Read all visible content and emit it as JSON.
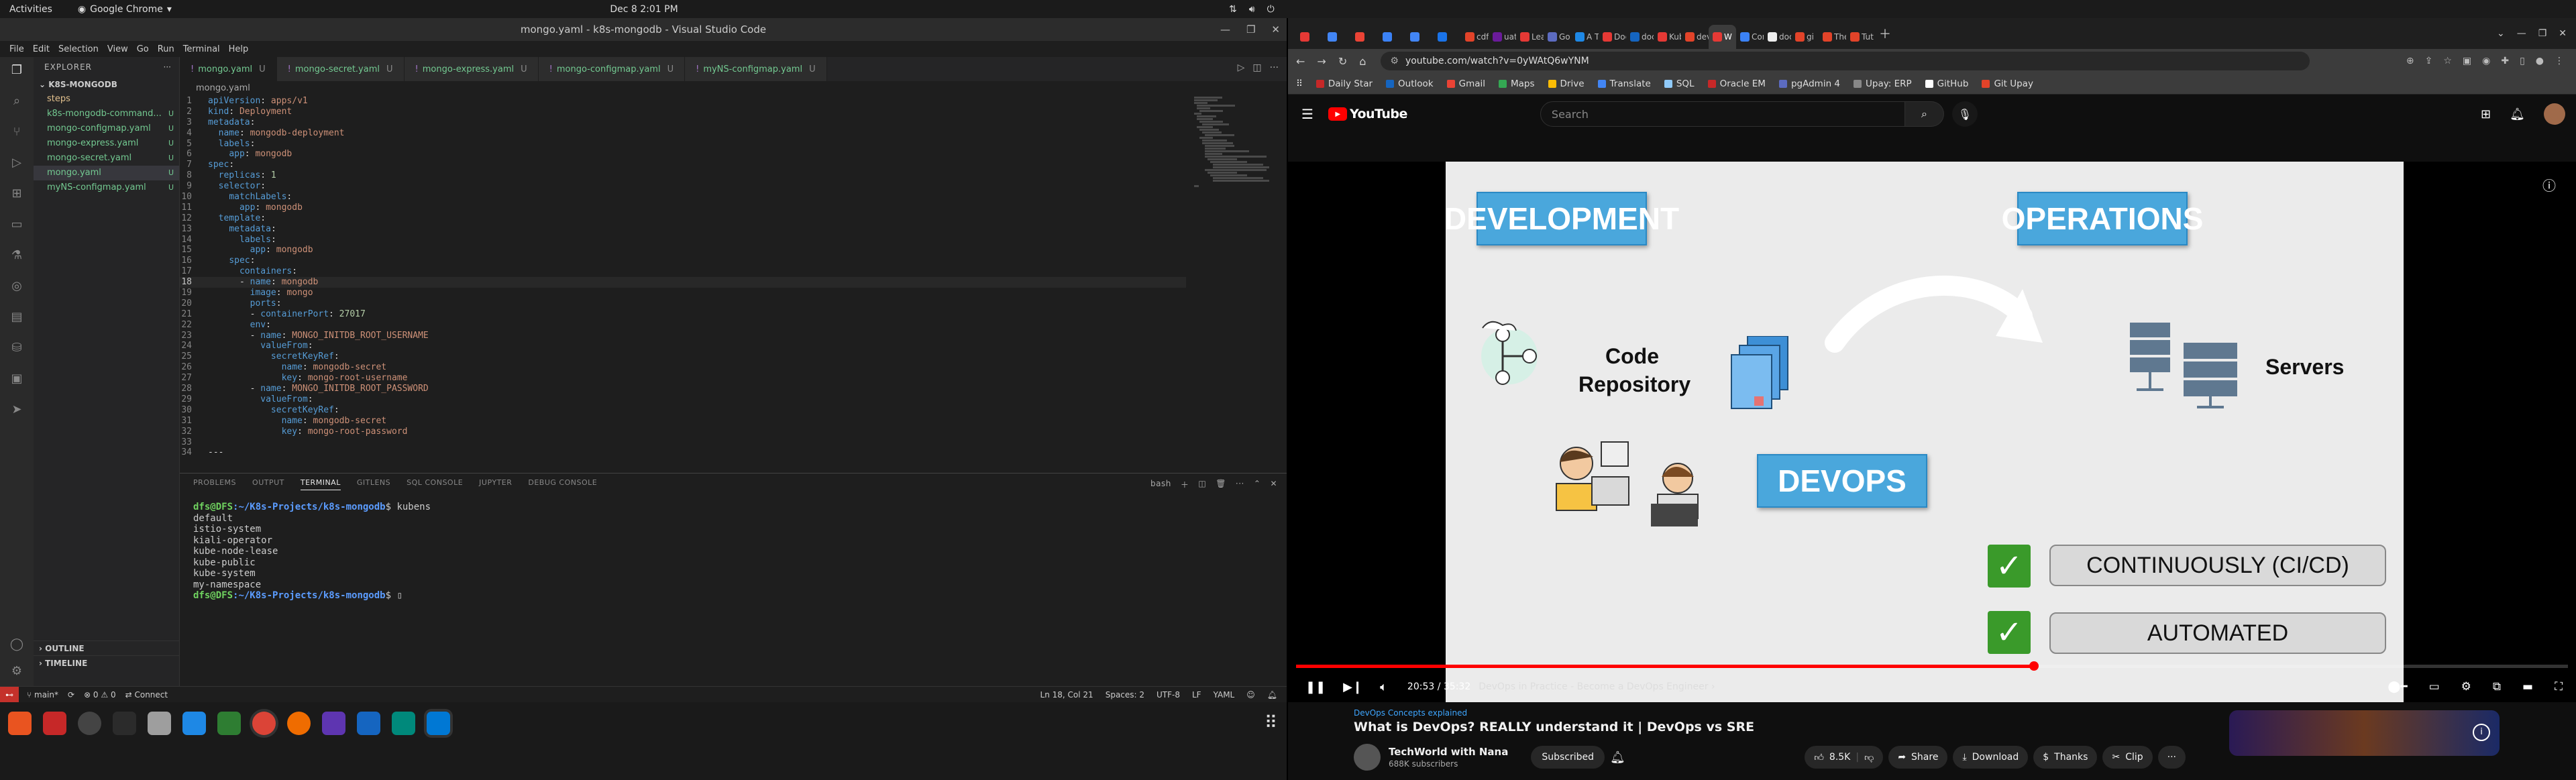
{
  "topbar": {
    "activities": "Activities",
    "app": "Google Chrome",
    "clock": "Dec 8  2:01 PM"
  },
  "vscode": {
    "title": "mongo.yaml - k8s-mongodb - Visual Studio Code",
    "menu": [
      "File",
      "Edit",
      "Selection",
      "View",
      "Go",
      "Run",
      "Terminal",
      "Help"
    ],
    "explorer_label": "EXPLORER",
    "folder": "K8S-MONGODB",
    "files": [
      {
        "name": "steps",
        "flag": "",
        "folder": true,
        "selected": false
      },
      {
        "name": "k8s-mongodb-command...",
        "flag": "U",
        "folder": false,
        "selected": false
      },
      {
        "name": "mongo-configmap.yaml",
        "flag": "U",
        "folder": false,
        "selected": false
      },
      {
        "name": "mongo-express.yaml",
        "flag": "U",
        "folder": false,
        "selected": false
      },
      {
        "name": "mongo-secret.yaml",
        "flag": "U",
        "folder": false,
        "selected": false
      },
      {
        "name": "mongo.yaml",
        "flag": "U",
        "folder": false,
        "selected": true
      },
      {
        "name": "myNS-configmap.yaml",
        "flag": "U",
        "folder": false,
        "selected": false
      }
    ],
    "outline": "OUTLINE",
    "timeline": "TIMELINE",
    "tabs": [
      {
        "label": "mongo.yaml",
        "flag": "U",
        "active": true
      },
      {
        "label": "mongo-secret.yaml",
        "flag": "U",
        "active": false
      },
      {
        "label": "mongo-express.yaml",
        "flag": "U",
        "active": false
      },
      {
        "label": "mongo-configmap.yaml",
        "flag": "U",
        "active": false
      },
      {
        "label": "myNS-configmap.yaml",
        "flag": "U",
        "active": false
      }
    ],
    "breadcrumb": "mongo.yaml",
    "code": [
      "apiVersion: apps/v1",
      "kind: Deployment",
      "metadata:",
      "  name: mongodb-deployment",
      "  labels:",
      "    app: mongodb",
      "spec:",
      "  replicas: 1",
      "  selector:",
      "    matchLabels:",
      "      app: mongodb",
      "  template:",
      "    metadata:",
      "      labels:",
      "        app: mongodb",
      "    spec:",
      "      containers:",
      "      - name: mongodb",
      "        image: mongo",
      "        ports:",
      "        - containerPort: 27017",
      "        env:",
      "        - name: MONGO_INITDB_ROOT_USERNAME",
      "          valueFrom:",
      "            secretKeyRef:",
      "              name: mongodb-secret",
      "              key: mongo-root-username",
      "        - name: MONGO_INITDB_ROOT_PASSWORD",
      "          valueFrom:",
      "            secretKeyRef:",
      "              name: mongodb-secret",
      "              key: mongo-root-password",
      "",
      "---"
    ],
    "current_line": 18,
    "panel_tabs": [
      "PROBLEMS",
      "OUTPUT",
      "TERMINAL",
      "GITLENS",
      "SQL CONSOLE",
      "JUPYTER",
      "DEBUG CONSOLE"
    ],
    "active_panel_tab": "TERMINAL",
    "terminal_shell": "bash",
    "terminal": {
      "prompt_user": "dfs@DFS",
      "prompt_path": ":~/K8s-Projects/k8s-mongodb",
      "command": "$ kubens",
      "output": [
        "default",
        "istio-system",
        "kiali-operator",
        "kube-node-lease",
        "kube-public",
        "kube-system",
        "my-namespace"
      ],
      "final_prompt_suffix": "$ ▯"
    },
    "status": {
      "branch": "main*",
      "problems": "⊗ 0 ⚠ 0",
      "connect": "Connect",
      "cursor": "Ln 18, Col 21",
      "spaces": "Spaces: 2",
      "encoding": "UTF-8",
      "eol": "LF",
      "language": "YAML"
    }
  },
  "chrome": {
    "tabs": [
      {
        "title": "",
        "color": "#e53935",
        "active": false
      },
      {
        "title": "",
        "color": "#4285f4",
        "active": false
      },
      {
        "title": "",
        "color": "#ea4335",
        "active": false
      },
      {
        "title": "",
        "color": "#3b82f6",
        "active": false
      },
      {
        "title": "",
        "color": "#4285f4",
        "active": false
      },
      {
        "title": "",
        "color": "#1a73e8",
        "active": false
      },
      {
        "title": "cdfs",
        "color": "#e24329",
        "active": false
      },
      {
        "title": "uat",
        "color": "#6a1b9a",
        "active": false
      },
      {
        "title": "Lea",
        "color": "#e53935",
        "active": false
      },
      {
        "title": "Go",
        "color": "#5c6bc0",
        "active": false
      },
      {
        "title": "A Te",
        "color": "#1e88e5",
        "active": false
      },
      {
        "title": "Doc",
        "color": "#e53935",
        "active": false
      },
      {
        "title": "doc",
        "color": "#1565c0",
        "active": false
      },
      {
        "title": "Kub",
        "color": "#e53935",
        "active": false
      },
      {
        "title": "dev",
        "color": "#e24329",
        "active": false
      },
      {
        "title": "W",
        "color": "#e53935",
        "active": true
      },
      {
        "title": "Con",
        "color": "#3b82f6",
        "active": false
      },
      {
        "title": "doc",
        "color": "#eeeeee",
        "active": false
      },
      {
        "title": "gi",
        "color": "#e24329",
        "active": false
      },
      {
        "title": "The",
        "color": "#e24329",
        "active": false
      },
      {
        "title": "Tut",
        "color": "#e24329",
        "active": false
      }
    ],
    "url": "youtube.com/watch?v=0yWAtQ6wYNM",
    "bookmarks": [
      {
        "label": "Daily Star",
        "color": "#c62828"
      },
      {
        "label": "Outlook",
        "color": "#1565c0"
      },
      {
        "label": "Gmail",
        "color": "#ea4335"
      },
      {
        "label": "Maps",
        "color": "#34a853"
      },
      {
        "label": "Drive",
        "color": "#fbbc04"
      },
      {
        "label": "Translate",
        "color": "#4285f4"
      },
      {
        "label": "SQL",
        "color": "#90caf9"
      },
      {
        "label": "Oracle EM",
        "color": "#c62828"
      },
      {
        "label": "pgAdmin 4",
        "color": "#5c6bc0"
      },
      {
        "label": "Upay: ERP",
        "color": "#888888"
      },
      {
        "label": "GitHub",
        "color": "#ffffff"
      },
      {
        "label": "Git Upay",
        "color": "#e24329"
      }
    ]
  },
  "youtube": {
    "logo": "YouTube",
    "search_placeholder": "Search",
    "slide": {
      "box1": "DEVELOPMENT",
      "box2": "OPERATIONS",
      "box3": "DEVOPS",
      "code_repo_1": "Code",
      "code_repo_2": "Repository",
      "servers": "Servers",
      "pill1": "CONTINUOUSLY (CI/CD)",
      "pill2": "AUTOMATED"
    },
    "progress": 0.58,
    "time": "20:53 / 35:32",
    "chapter": "DevOps in Practice - Become a DevOps Engineer  ›",
    "hashtag": "DevOps Concepts explained",
    "video_title": "What is DevOps? REALLY understand it | DevOps vs SRE",
    "channel": "TechWorld with Nana",
    "subscribers": "688K subscribers",
    "subscribed": "Subscribed",
    "likes": "8.5K",
    "share": "Share",
    "download": "Download",
    "thanks": "Thanks",
    "clip": "Clip",
    "more": "···"
  }
}
